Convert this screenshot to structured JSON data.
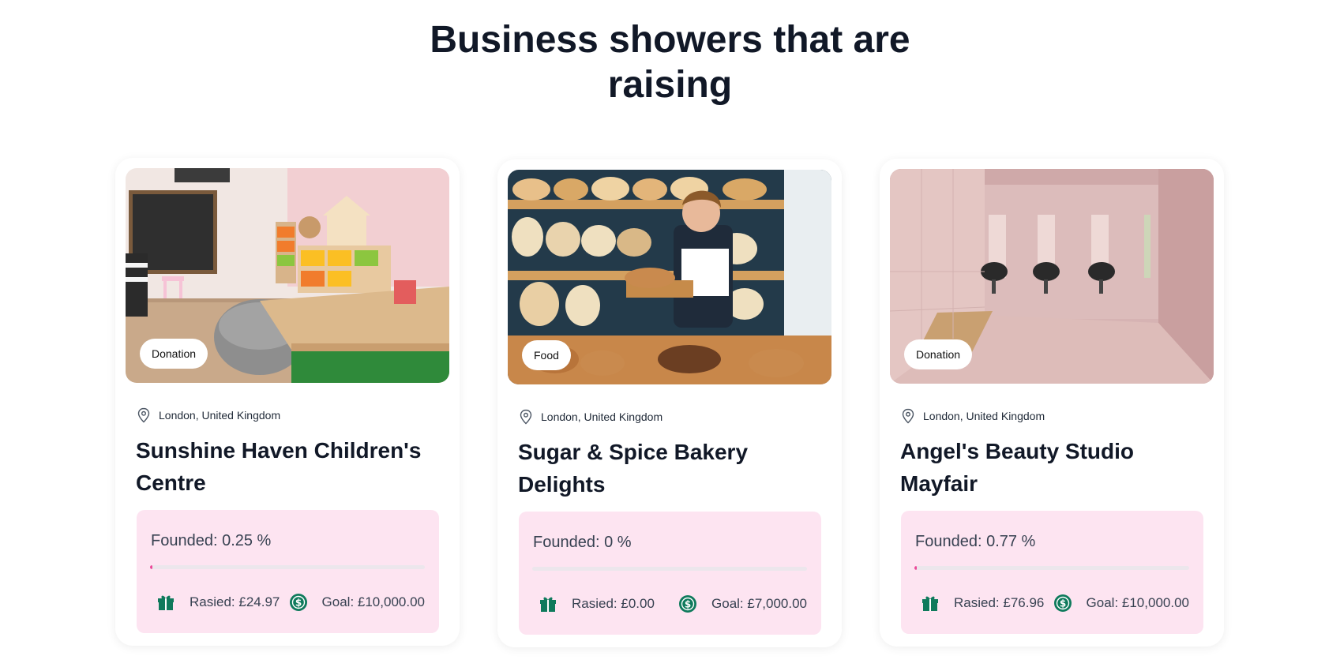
{
  "heading": {
    "line1": "Business showers that are",
    "line2": "raising"
  },
  "colors": {
    "accent": "#ec4899",
    "stats_background": "#fde4f1",
    "icon_green": "#0f7a5c"
  },
  "cards": [
    {
      "tag": "Donation",
      "location": "London, United Kingdom",
      "title": "Sunshine Haven Children's Centre",
      "founded": "Founded: 0.25 %",
      "progress_percent": 0.25,
      "raised": "Rasied: £24.97",
      "goal": "Goal: £10,000.00",
      "image": "children-playroom"
    },
    {
      "tag": "Food",
      "location": "London, United Kingdom",
      "title": "Sugar & Spice Bakery Delights",
      "founded": "Founded: 0 %",
      "progress_percent": 0,
      "raised": "Rasied: £0.00",
      "goal": "Goal: £7,000.00",
      "image": "bakery-shelves"
    },
    {
      "tag": "Donation",
      "location": "London, United Kingdom",
      "title": "Angel's Beauty Studio Mayfair",
      "founded": "Founded: 0.77 %",
      "progress_percent": 0.77,
      "raised": "Rasied: £76.96",
      "goal": "Goal: £10,000.00",
      "image": "pink-salon"
    }
  ]
}
